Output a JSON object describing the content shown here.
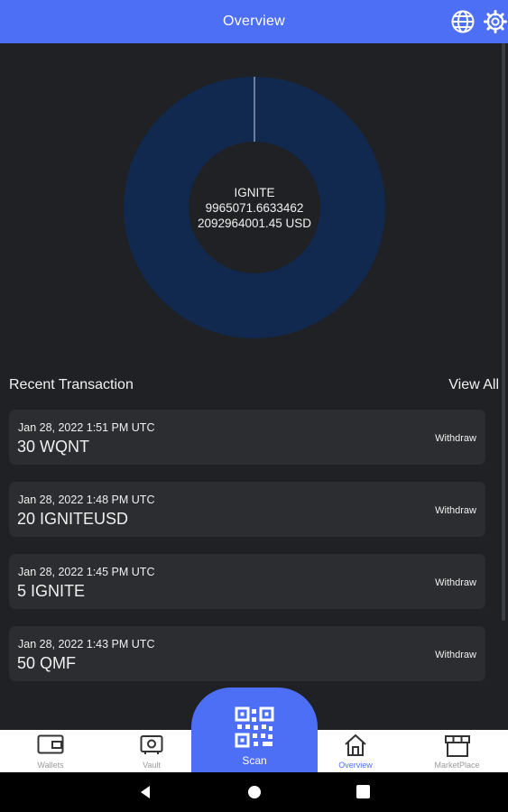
{
  "header": {
    "title": "Overview",
    "icons": [
      "globe-icon",
      "gear-icon"
    ]
  },
  "chart_data": {
    "type": "pie",
    "style": "donut",
    "slices": [
      {
        "label": "IGNITE",
        "value": 9965071.6633462
      }
    ],
    "center": {
      "name": "IGNITE",
      "amount": "9965071.6633462",
      "usd": "2092964001.45 USD"
    },
    "colors": {
      "slice_fill": "#11284f",
      "center_fill": "#1f2124"
    }
  },
  "transactions": {
    "title": "Recent Transaction",
    "view_all": "View All",
    "items": [
      {
        "date": "Jan 28, 2022 1:51 PM UTC",
        "amount": "30 WQNT",
        "type": "Withdraw"
      },
      {
        "date": "Jan 28, 2022 1:48 PM UTC",
        "amount": "20 IGNITEUSD",
        "type": "Withdraw"
      },
      {
        "date": "Jan 28, 2022 1:45 PM UTC",
        "amount": "5 IGNITE",
        "type": "Withdraw"
      },
      {
        "date": "Jan 28, 2022 1:43 PM UTC",
        "amount": "50 QMF",
        "type": "Withdraw"
      }
    ]
  },
  "nav": {
    "wallets": "Wallets",
    "vault": "Vault",
    "scan": "Scan",
    "overview": "Overview",
    "marketplace": "MarketPlace",
    "active": "overview"
  },
  "colors": {
    "accent": "#4d6ff6",
    "background": "#1f2124",
    "card": "#2b2d31"
  }
}
